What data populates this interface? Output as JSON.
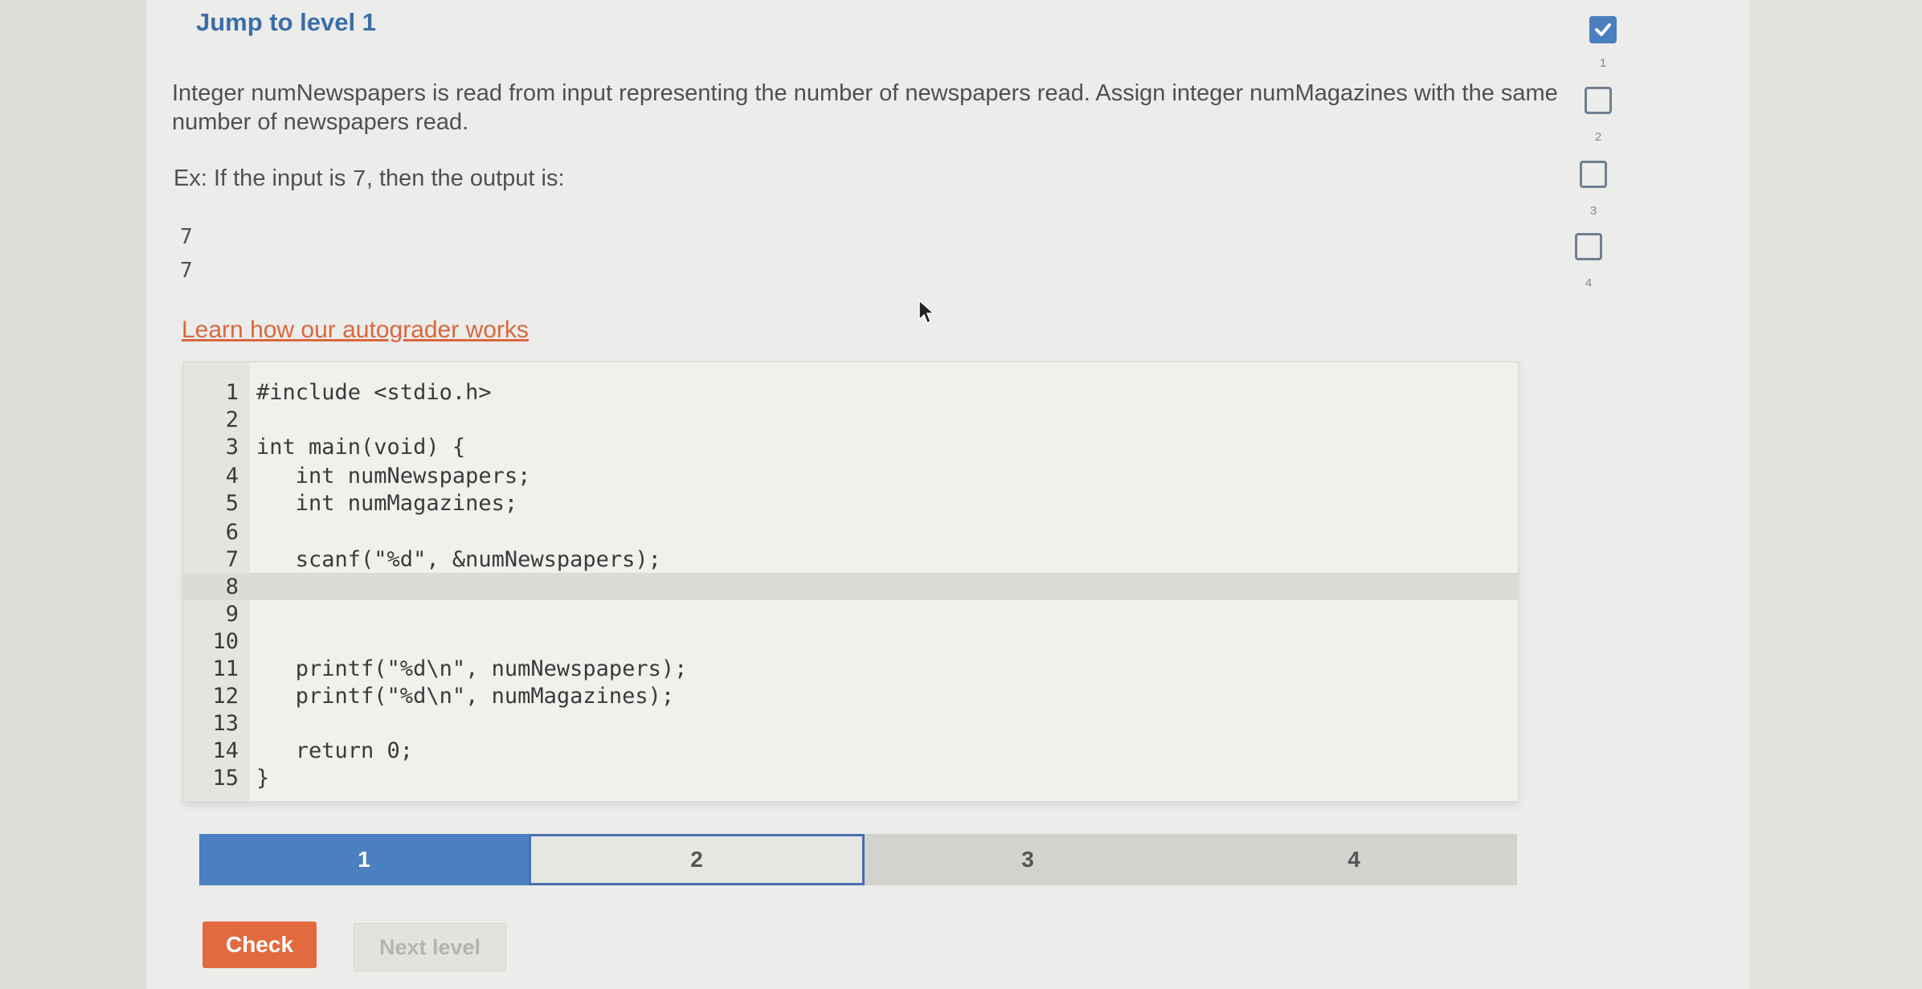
{
  "header": {
    "jump_label": "Jump to level 1"
  },
  "task": {
    "description": "Integer numNewspapers is read from input representing the number of newspapers read. Assign integer numMagazines with the same number of newspapers read.",
    "example_prefix": "Ex: If the input is ",
    "example_input": "7",
    "example_suffix": ", then the output is:",
    "output_lines": [
      "7",
      "7"
    ]
  },
  "learn_link": "Learn how our autograder works",
  "editor": {
    "active_line": 8,
    "lines": [
      {
        "num": "1",
        "code": "#include <stdio.h>"
      },
      {
        "num": "2",
        "code": ""
      },
      {
        "num": "3",
        "code": "int main(void) {"
      },
      {
        "num": "4",
        "code": "   int numNewspapers;"
      },
      {
        "num": "5",
        "code": "   int numMagazines;"
      },
      {
        "num": "6",
        "code": ""
      },
      {
        "num": "7",
        "code": "   scanf(\"%d\", &numNewspapers);"
      },
      {
        "num": "8",
        "code": ""
      },
      {
        "num": "9",
        "code": ""
      },
      {
        "num": "10",
        "code": ""
      },
      {
        "num": "11",
        "code": "   printf(\"%d\\n\", numNewspapers);"
      },
      {
        "num": "12",
        "code": "   printf(\"%d\\n\", numMagazines);"
      },
      {
        "num": "13",
        "code": ""
      },
      {
        "num": "14",
        "code": "   return 0;"
      },
      {
        "num": "15",
        "code": "}"
      }
    ]
  },
  "progress": {
    "tabs": [
      {
        "label": "1",
        "state": "done"
      },
      {
        "label": "2",
        "state": "current"
      },
      {
        "label": "3",
        "state": "todo"
      },
      {
        "label": "4",
        "state": "todo"
      }
    ]
  },
  "buttons": {
    "check": "Check",
    "next_level": "Next level"
  },
  "levels": [
    {
      "num": "1",
      "checked": true
    },
    {
      "num": "2",
      "checked": false
    },
    {
      "num": "3",
      "checked": false
    },
    {
      "num": "4",
      "checked": false
    }
  ],
  "colors": {
    "accent": "#4a7fc0",
    "check_button": "#e16a3f",
    "link": "#d9673e"
  }
}
